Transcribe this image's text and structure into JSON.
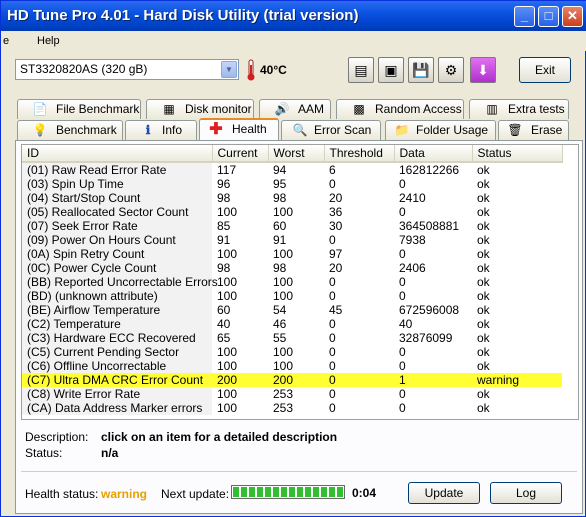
{
  "window": {
    "title": "HD Tune Pro 4.01 - Hard Disk Utility (trial version)"
  },
  "titlebar_buttons": {
    "minimize": "_",
    "maximize": "□",
    "close": "✕"
  },
  "menu": [
    {
      "label": "e"
    },
    {
      "label": "Help"
    }
  ],
  "drive": {
    "selected": "ST3320820AS (320 gB)",
    "temperature": "40°C"
  },
  "toolbar": {
    "icons": [
      "copy-text-icon",
      "copy-screenshot-icon",
      "save-icon",
      "options-icon",
      "download-icon"
    ],
    "exit_label": "Exit"
  },
  "tabs_row1": [
    {
      "label": "File Benchmark",
      "icon": "file-benchmark-icon"
    },
    {
      "label": "Disk monitor",
      "icon": "disk-monitor-icon"
    },
    {
      "label": "AAM",
      "icon": "speaker-icon"
    },
    {
      "label": "Random Access",
      "icon": "random-access-icon"
    },
    {
      "label": "Extra tests",
      "icon": "extra-tests-icon"
    }
  ],
  "tabs_row2": [
    {
      "label": "Benchmark",
      "icon": "benchmark-icon"
    },
    {
      "label": "Info",
      "icon": "info-icon"
    },
    {
      "label": "Health",
      "icon": "health-cross-icon",
      "active": true
    },
    {
      "label": "Error Scan",
      "icon": "magnifier-icon"
    },
    {
      "label": "Folder Usage",
      "icon": "folder-icon"
    },
    {
      "label": "Erase",
      "icon": "trash-icon"
    }
  ],
  "table": {
    "columns": [
      "ID",
      "Current",
      "Worst",
      "Threshold",
      "Data",
      "Status"
    ],
    "rows": [
      [
        "(01) Raw Read Error Rate",
        "117",
        "94",
        "6",
        "162812266",
        "ok"
      ],
      [
        "(03) Spin Up Time",
        "96",
        "95",
        "0",
        "0",
        "ok"
      ],
      [
        "(04) Start/Stop Count",
        "98",
        "98",
        "20",
        "2410",
        "ok"
      ],
      [
        "(05) Reallocated Sector Count",
        "100",
        "100",
        "36",
        "0",
        "ok"
      ],
      [
        "(07) Seek Error Rate",
        "85",
        "60",
        "30",
        "364508881",
        "ok"
      ],
      [
        "(09) Power On Hours Count",
        "91",
        "91",
        "0",
        "7938",
        "ok"
      ],
      [
        "(0A) Spin Retry Count",
        "100",
        "100",
        "97",
        "0",
        "ok"
      ],
      [
        "(0C) Power Cycle Count",
        "98",
        "98",
        "20",
        "2406",
        "ok"
      ],
      [
        "(BB) Reported Uncorrectable Errors",
        "100",
        "100",
        "0",
        "0",
        "ok"
      ],
      [
        "(BD) (unknown attribute)",
        "100",
        "100",
        "0",
        "0",
        "ok"
      ],
      [
        "(BE) Airflow Temperature",
        "60",
        "54",
        "45",
        "672596008",
        "ok"
      ],
      [
        "(C2) Temperature",
        "40",
        "46",
        "0",
        "40",
        "ok"
      ],
      [
        "(C3) Hardware ECC Recovered",
        "65",
        "55",
        "0",
        "32876099",
        "ok"
      ],
      [
        "(C5) Current Pending Sector",
        "100",
        "100",
        "0",
        "0",
        "ok"
      ],
      [
        "(C6) Offline Uncorrectable",
        "100",
        "100",
        "0",
        "0",
        "ok"
      ],
      [
        "(C7) Ultra DMA CRC Error Count",
        "200",
        "200",
        "0",
        "1",
        "warning"
      ],
      [
        "(C8) Write Error Rate",
        "100",
        "253",
        "0",
        "0",
        "ok"
      ],
      [
        "(CA) Data Address Marker errors",
        "100",
        "253",
        "0",
        "0",
        "ok"
      ]
    ],
    "highlight_row": 15,
    "highlight_color": "#ffff33"
  },
  "description": {
    "label": "Description:",
    "value": "click on an item for a detailed description",
    "status_label": "Status:",
    "status_value": "n/a"
  },
  "footer": {
    "health_label": "Health status:",
    "health_value": "warning",
    "health_color": "#e8a000",
    "next_update_label": "Next update:",
    "next_update_progress": 1.0,
    "countdown": "0:04",
    "update_label": "Update",
    "log_label": "Log"
  }
}
